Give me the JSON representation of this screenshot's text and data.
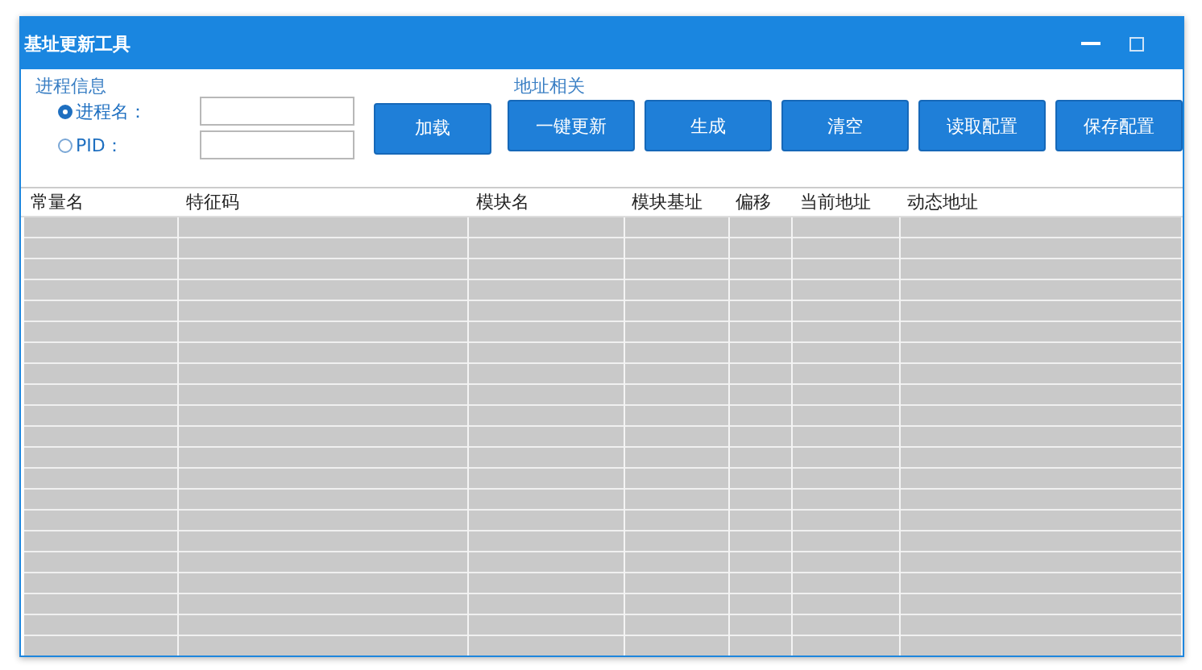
{
  "window": {
    "title": "基址更新工具"
  },
  "process_info": {
    "title": "进程信息",
    "options": [
      {
        "label": "进程名：",
        "selected": true
      },
      {
        "label": "PID：",
        "selected": false
      }
    ],
    "load_button": "加载"
  },
  "address_section": {
    "title": "地址相关",
    "buttons": [
      "一键更新",
      "生成",
      "清空",
      "读取配置",
      "保存配置"
    ]
  },
  "table": {
    "columns": [
      "常量名",
      "特征码",
      "模块名",
      "模块基址",
      "偏移",
      "当前地址",
      "动态地址"
    ]
  }
}
